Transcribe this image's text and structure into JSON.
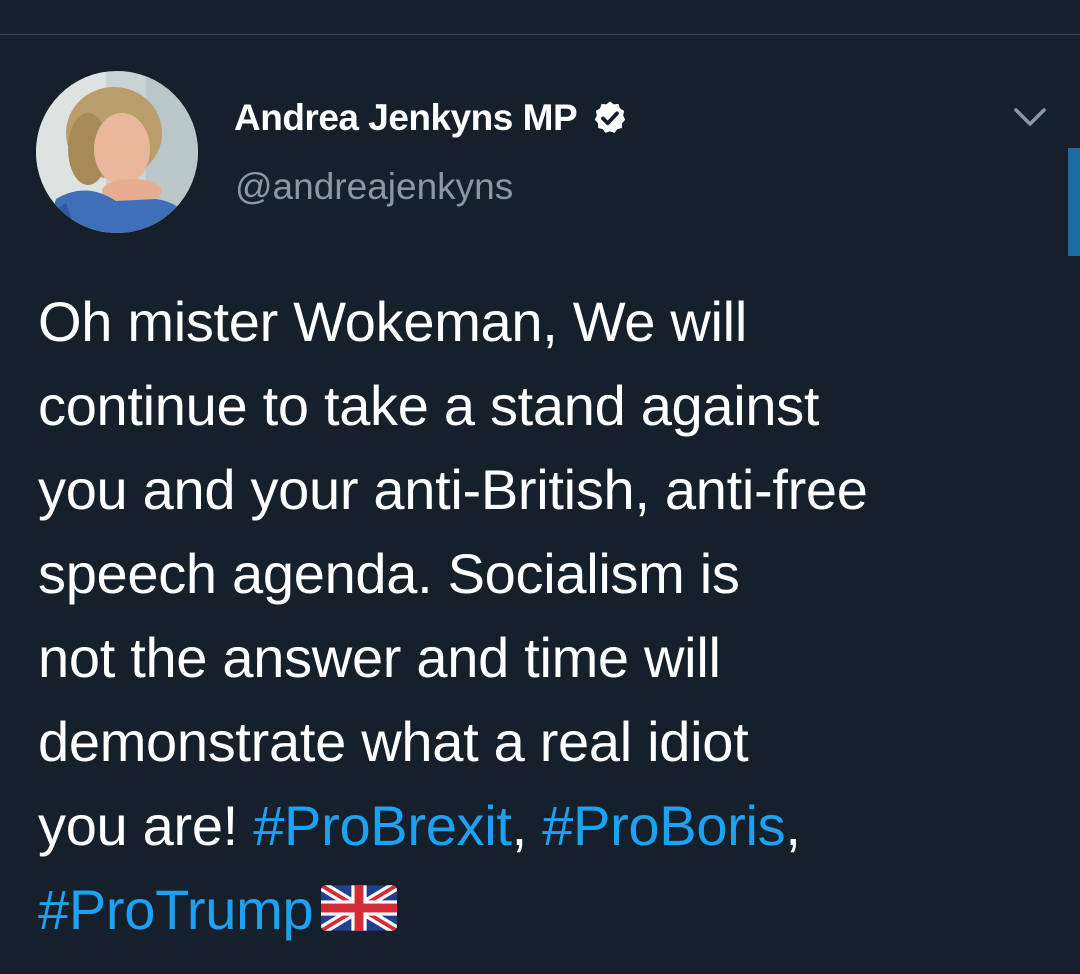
{
  "author": {
    "display_name": "Andrea Jenkyns MP",
    "handle": "@andreajenkyns",
    "verified": true,
    "avatar_icon": "profile-photo"
  },
  "tweet": {
    "lines": [
      {
        "text": "Oh mister Wokeman, We will"
      },
      {
        "text": "continue to take a stand against"
      },
      {
        "text": "you and your anti-British, anti-free"
      },
      {
        "text": "speech agenda. Socialism is"
      },
      {
        "text": "not the answer and time will"
      },
      {
        "text": "demonstrate what a real idiot"
      },
      {
        "text": "you are! "
      }
    ],
    "hashtags": [
      "#ProBrexit",
      "#ProBoris",
      "#ProTrump"
    ],
    "separator_1": ", ",
    "separator_2": ",",
    "emoji": "uk-flag-icon"
  },
  "colors": {
    "background": "#15202b",
    "text_primary": "#ffffff",
    "text_secondary": "#8899a6",
    "hashtag": "#1da1f2",
    "divider": "#38444d",
    "scroll_indicator": "#1b6ca1"
  }
}
